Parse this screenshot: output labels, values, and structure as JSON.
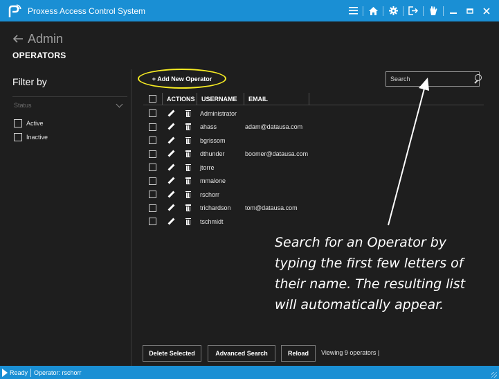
{
  "titlebar": {
    "app_title": "Proxess Access Control System",
    "icons": [
      "menu-icon",
      "home-icon",
      "settings-icon",
      "logout-icon",
      "hand-icon",
      "minimize-icon",
      "maximize-icon",
      "close-icon"
    ]
  },
  "header": {
    "back_label": "Admin",
    "section_title": "OPERATORS"
  },
  "filter": {
    "title": "Filter by",
    "status_label": "Status",
    "options": [
      {
        "label": "Active"
      },
      {
        "label": "Inactive"
      }
    ]
  },
  "toolbar": {
    "add_label": "+ Add New Operator",
    "search_placeholder": "Search",
    "highlight_color": "#f5ea23"
  },
  "table": {
    "columns": [
      "ACTIONS",
      "USERNAME",
      "EMAIL"
    ],
    "rows": [
      {
        "username": "Administrator",
        "email": ""
      },
      {
        "username": "ahass",
        "email": "adam@datausa.com"
      },
      {
        "username": "bgrissom",
        "email": ""
      },
      {
        "username": "dthunder",
        "email": "boomer@datausa.com"
      },
      {
        "username": "jtorre",
        "email": ""
      },
      {
        "username": "mmalone",
        "email": ""
      },
      {
        "username": "rschorr",
        "email": ""
      },
      {
        "username": "trichardson",
        "email": "tom@datausa.com"
      },
      {
        "username": "tschmidt",
        "email": ""
      }
    ]
  },
  "callout": {
    "text": "Search for an Operator by typing the first few letters of their name. The resulting list will automatically appear."
  },
  "footer": {
    "delete_label": "Delete Selected",
    "advanced_label": "Advanced Search",
    "reload_label": "Reload",
    "viewing_text": "Viewing 9 operators |"
  },
  "statusbar": {
    "ready": "Ready",
    "operator": "Operator: rschorr"
  },
  "colors": {
    "accent": "#1a8fd4",
    "background": "#1e1e1e",
    "highlight": "#f5ea23"
  }
}
